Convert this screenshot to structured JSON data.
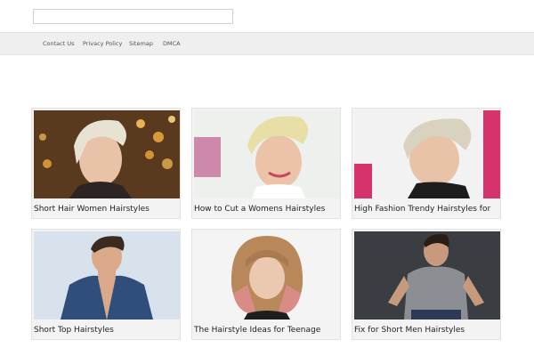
{
  "search": {
    "value": "",
    "placeholder": ""
  },
  "nav": {
    "items": [
      {
        "label": "Contact Us"
      },
      {
        "label": "Privacy Policy"
      },
      {
        "label": "Sitemap"
      },
      {
        "label": "DMCA"
      }
    ]
  },
  "posts": [
    {
      "title": "Short Hair Women Hairstyles",
      "image": "woman-platinum-pixie-bokeh-lights"
    },
    {
      "title": "How to Cut a Womens Hairstyles",
      "image": "woman-blonde-undercut-quiff"
    },
    {
      "title": "High Fashion Trendy Hairstyles for",
      "image": "woman-blonde-pixie-pink-backdrop"
    },
    {
      "title": "Short Top Hairstyles",
      "image": "man-denim-jacket-short-top"
    },
    {
      "title": "The Hairstyle Ideas for Teenage",
      "image": "woman-ombre-bob-bangs"
    },
    {
      "title": "Fix for Short Men Hairstyles",
      "image": "man-grey-henley-dark-background"
    }
  ],
  "colors": {
    "nav_bar": "#efefef",
    "card_bg": "#f3f3f3",
    "text": "#222222"
  }
}
